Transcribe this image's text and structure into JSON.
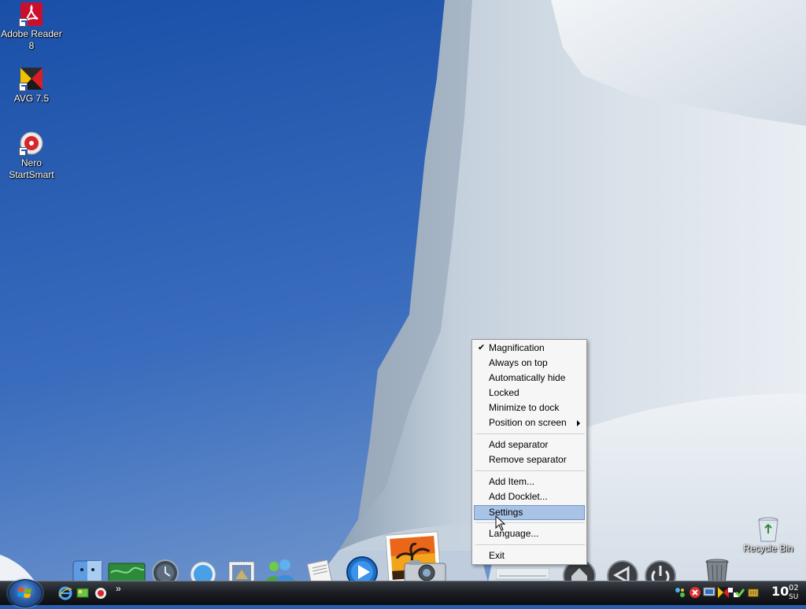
{
  "desktop": {
    "icons": [
      {
        "label_line1": "Adobe Reader",
        "label_line2": "8",
        "icon": "adobe-reader-icon"
      },
      {
        "label_line1": "AVG 7.5",
        "label_line2": "",
        "icon": "avg-icon"
      },
      {
        "label_line1": "Nero",
        "label_line2": "StartSmart",
        "icon": "nero-icon"
      }
    ],
    "recycle_bin": {
      "label": "Recycle Bin",
      "icon": "recycle-bin-icon"
    }
  },
  "context_menu": {
    "items": [
      {
        "label": "Magnification",
        "checked": true
      },
      {
        "label": "Always on top"
      },
      {
        "label": "Automatically hide"
      },
      {
        "label": "Locked"
      },
      {
        "label": "Minimize to dock"
      },
      {
        "label": "Position on screen",
        "submenu": true
      },
      {
        "label": "Add separator"
      },
      {
        "label": "Remove separator"
      },
      {
        "label": "Add Item..."
      },
      {
        "label": "Add Docklet..."
      },
      {
        "label": "Settings",
        "highlighted": true
      },
      {
        "label": "Language..."
      },
      {
        "label": "Exit"
      }
    ],
    "check_glyph": "✔"
  },
  "taskbar": {
    "quick_launch_more": "»",
    "clock": {
      "hour": "10",
      "minute": "02",
      "day": "SU"
    }
  },
  "colors": {
    "sky_top": "#1d57b0",
    "sky_bottom": "#5f86c4",
    "menu_highlight": "#a9c3e6",
    "taskbar": "#1c1f24"
  }
}
